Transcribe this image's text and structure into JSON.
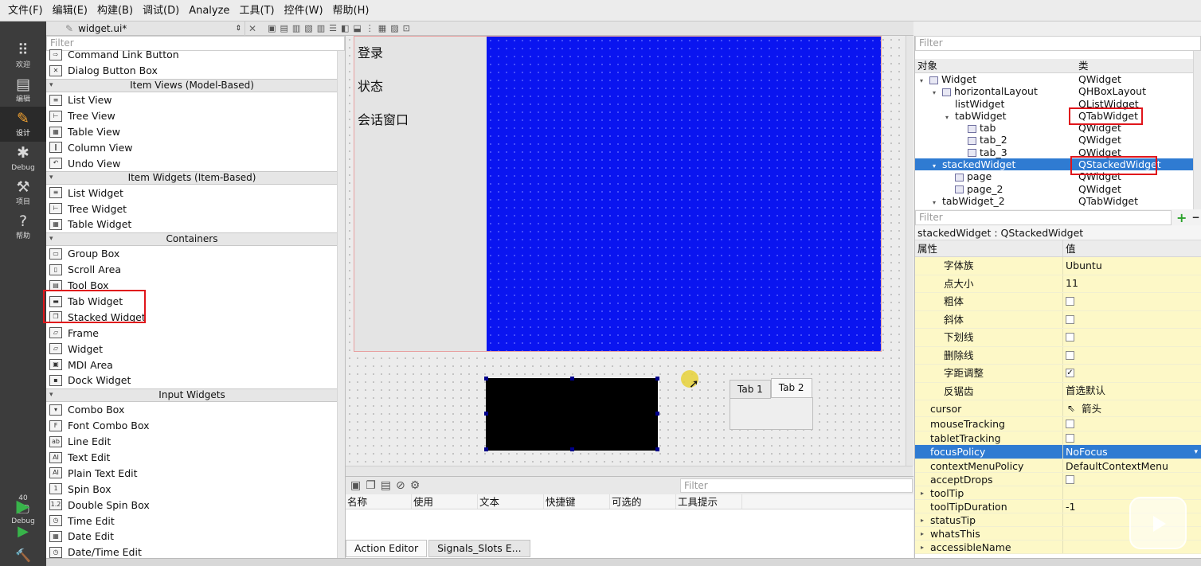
{
  "menubar": [
    "文件(F)",
    "编辑(E)",
    "构建(B)",
    "调试(D)",
    "Analyze",
    "工具(T)",
    "控件(W)",
    "帮助(H)"
  ],
  "modes": [
    {
      "label": "欢迎",
      "icon": "grid-icon"
    },
    {
      "label": "编辑",
      "icon": "document-icon"
    },
    {
      "label": "设计",
      "icon": "pencil-icon"
    },
    {
      "label": "Debug",
      "icon": "bug-icon"
    },
    {
      "label": "项目",
      "icon": "wrench-icon"
    },
    {
      "label": "帮助",
      "icon": "help-icon"
    }
  ],
  "kit": {
    "number": "40",
    "label": "Debug"
  },
  "editor_tab": {
    "file": "widget.ui*"
  },
  "widgetbox": {
    "filter_placeholder": "Filter",
    "items": [
      {
        "type": "item",
        "label": "Command Link Button",
        "g": "⇨"
      },
      {
        "type": "item",
        "label": "Dialog Button Box",
        "g": "✕"
      },
      {
        "type": "cat",
        "label": "Item Views (Model-Based)"
      },
      {
        "type": "item",
        "label": "List View",
        "g": "≡"
      },
      {
        "type": "item",
        "label": "Tree View",
        "g": "⊢"
      },
      {
        "type": "item",
        "label": "Table View",
        "g": "▦"
      },
      {
        "type": "item",
        "label": "Column View",
        "g": "‖"
      },
      {
        "type": "item",
        "label": "Undo View",
        "g": "↶"
      },
      {
        "type": "cat",
        "label": "Item Widgets (Item-Based)"
      },
      {
        "type": "item",
        "label": "List Widget",
        "g": "≡"
      },
      {
        "type": "item",
        "label": "Tree Widget",
        "g": "⊢"
      },
      {
        "type": "item",
        "label": "Table Widget",
        "g": "▦"
      },
      {
        "type": "cat",
        "label": "Containers"
      },
      {
        "type": "item",
        "label": "Group Box",
        "g": "▭"
      },
      {
        "type": "item",
        "label": "Scroll Area",
        "g": "▯"
      },
      {
        "type": "item",
        "label": "Tool Box",
        "g": "▤"
      },
      {
        "type": "item",
        "label": "Tab Widget",
        "g": "▬"
      },
      {
        "type": "item",
        "label": "Stacked Widget",
        "g": "❐"
      },
      {
        "type": "item",
        "label": "Frame",
        "g": "▱"
      },
      {
        "type": "item",
        "label": "Widget",
        "g": "▱"
      },
      {
        "type": "item",
        "label": "MDI Area",
        "g": "▣"
      },
      {
        "type": "item",
        "label": "Dock Widget",
        "g": "▪"
      },
      {
        "type": "cat",
        "label": "Input Widgets"
      },
      {
        "type": "item",
        "label": "Combo Box",
        "g": "▾"
      },
      {
        "type": "item",
        "label": "Font Combo Box",
        "g": "F"
      },
      {
        "type": "item",
        "label": "Line Edit",
        "g": "ab"
      },
      {
        "type": "item",
        "label": "Text Edit",
        "g": "AI"
      },
      {
        "type": "item",
        "label": "Plain Text Edit",
        "g": "AI"
      },
      {
        "type": "item",
        "label": "Spin Box",
        "g": "1"
      },
      {
        "type": "item",
        "label": "Double Spin Box",
        "g": "1.2"
      },
      {
        "type": "item",
        "label": "Time Edit",
        "g": "◷"
      },
      {
        "type": "item",
        "label": "Date Edit",
        "g": "▦"
      },
      {
        "type": "item",
        "label": "Date/Time Edit",
        "g": "◷"
      }
    ]
  },
  "form": {
    "list_items": [
      "登录",
      "状态",
      "会话窗口"
    ],
    "tabwidget2_tabs": [
      "Tab 1",
      "Tab 2"
    ]
  },
  "action_editor": {
    "filter_placeholder": "Filter",
    "columns": [
      "名称",
      "使用",
      "文本",
      "快捷键",
      "可选的",
      "工具提示"
    ],
    "tabs": [
      "Action Editor",
      "Signals_Slots E..."
    ]
  },
  "object_inspector": {
    "filter_placeholder": "Filter",
    "col_object": "对象",
    "col_class": "类",
    "rows": [
      {
        "indent": 0,
        "tri": "▾",
        "icon": true,
        "name": "Widget",
        "cls": "QWidget"
      },
      {
        "indent": 1,
        "tri": "▾",
        "icon": true,
        "name": "horizontalLayout",
        "cls": "QHBoxLayout"
      },
      {
        "indent": 2,
        "tri": "",
        "icon": false,
        "name": "listWidget",
        "cls": "QListWidget"
      },
      {
        "indent": 2,
        "tri": "▾",
        "icon": false,
        "name": "tabWidget",
        "cls": "QTabWidget"
      },
      {
        "indent": 3,
        "tri": "",
        "icon": true,
        "name": "tab",
        "cls": "QWidget"
      },
      {
        "indent": 3,
        "tri": "",
        "icon": true,
        "name": "tab_2",
        "cls": "QWidget"
      },
      {
        "indent": 3,
        "tri": "",
        "icon": true,
        "name": "tab_3",
        "cls": "QWidget"
      },
      {
        "indent": 1,
        "tri": "▾",
        "icon": false,
        "name": "stackedWidget",
        "cls": "QStackedWidget",
        "sel": true
      },
      {
        "indent": 2,
        "tri": "",
        "icon": true,
        "name": "page",
        "cls": "QWidget"
      },
      {
        "indent": 2,
        "tri": "",
        "icon": true,
        "name": "page_2",
        "cls": "QWidget"
      },
      {
        "indent": 1,
        "tri": "▾",
        "icon": false,
        "name": "tabWidget_2",
        "cls": "QTabWidget"
      }
    ]
  },
  "property_editor": {
    "filter_placeholder": "Filter",
    "class_line": "stackedWidget : QStackedWidget",
    "col_prop": "属性",
    "col_value": "值",
    "rows": [
      {
        "k": "字体族",
        "v": "Ubuntu",
        "bg": "y",
        "ind": 2,
        "h": 22.5
      },
      {
        "k": "点大小",
        "v": "11",
        "bg": "y",
        "ind": 2,
        "h": 22.5
      },
      {
        "k": "粗体",
        "v": "",
        "chk": "off",
        "bg": "y",
        "ind": 2,
        "h": 22.5
      },
      {
        "k": "斜体",
        "v": "",
        "chk": "off",
        "bg": "y",
        "ind": 2,
        "h": 22.5
      },
      {
        "k": "下划线",
        "v": "",
        "chk": "off",
        "bg": "y",
        "ind": 2,
        "h": 22.5
      },
      {
        "k": "删除线",
        "v": "",
        "chk": "off",
        "bg": "y",
        "ind": 2,
        "h": 22.5
      },
      {
        "k": "字距调整",
        "v": "",
        "chk": "on",
        "bg": "y",
        "ind": 2,
        "h": 22.5
      },
      {
        "k": "反锯齿",
        "v": "首选默认",
        "bg": "y",
        "ind": 2,
        "h": 22.5
      },
      {
        "k": "cursor",
        "v": "箭头",
        "arrow": true,
        "bg": "y",
        "ind": 1,
        "h": 21
      },
      {
        "k": "mouseTracking",
        "v": "",
        "chk": "off",
        "bg": "y",
        "ind": 1,
        "h": 18
      },
      {
        "k": "tabletTracking",
        "v": "",
        "chk": "off",
        "bg": "y",
        "ind": 1,
        "h": 17
      },
      {
        "k": "focusPolicy",
        "v": "NoFocus",
        "dd": true,
        "bg": "sel",
        "ind": 1,
        "h": 18
      },
      {
        "k": "contextMenuPolicy",
        "v": "DefaultContextMenu",
        "bg": "y",
        "ind": 1,
        "h": 17
      },
      {
        "k": "acceptDrops",
        "v": "",
        "chk": "off",
        "bg": "y",
        "ind": 1,
        "h": 17
      },
      {
        "k": "toolTip",
        "v": "",
        "bg": "y",
        "ind": 1,
        "tri": true,
        "h": 17
      },
      {
        "k": "toolTipDuration",
        "v": "-1",
        "bg": "y",
        "ind": 1,
        "h": 17
      },
      {
        "k": "statusTip",
        "v": "",
        "bg": "y",
        "ind": 1,
        "tri": true,
        "h": 17
      },
      {
        "k": "whatsThis",
        "v": "",
        "bg": "y",
        "ind": 1,
        "tri": true,
        "h": 17
      },
      {
        "k": "accessibleName",
        "v": "",
        "bg": "y",
        "ind": 1,
        "tri": true,
        "h": 17
      }
    ]
  },
  "colors": {
    "accent": "#2f7bd2",
    "highlight_border": "#e0151b",
    "stacked_bg": "#0a15f0"
  }
}
